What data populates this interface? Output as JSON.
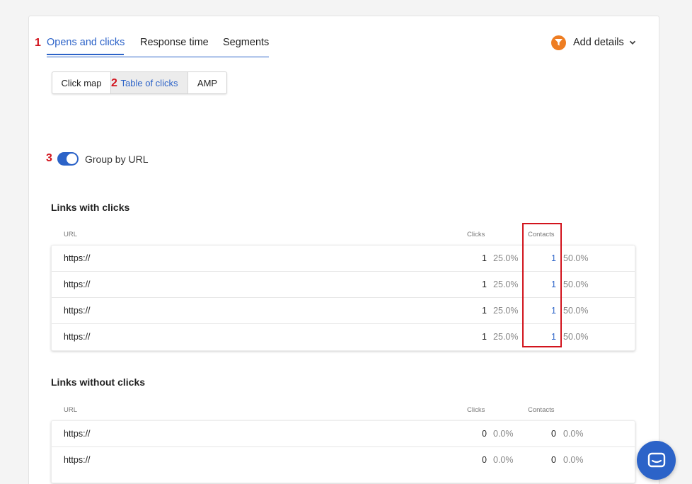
{
  "markers": {
    "m1": "1",
    "m2": "2",
    "m3": "3"
  },
  "tabs": [
    {
      "label": "Opens and clicks",
      "active": true
    },
    {
      "label": "Response time",
      "active": false
    },
    {
      "label": "Segments",
      "active": false
    }
  ],
  "add_details": {
    "label": "Add details",
    "icon": "filter-icon",
    "color": "#ee7d22"
  },
  "view_switch": [
    {
      "label": "Click map",
      "active": false
    },
    {
      "label": "Table of clicks",
      "active": true
    },
    {
      "label": "AMP",
      "active": false
    }
  ],
  "group_toggle": {
    "label": "Group by URL",
    "on": true
  },
  "links_with_clicks": {
    "title": "Links with clicks",
    "columns": {
      "url": "URL",
      "clicks": "Clicks",
      "contacts": "Contacts"
    },
    "rows": [
      {
        "url": "https://",
        "clicks": "1",
        "clicks_pct": "25.0%",
        "contacts": "1",
        "contacts_pct": "50.0%"
      },
      {
        "url": "https://",
        "clicks": "1",
        "clicks_pct": "25.0%",
        "contacts": "1",
        "contacts_pct": "50.0%"
      },
      {
        "url": "https://",
        "clicks": "1",
        "clicks_pct": "25.0%",
        "contacts": "1",
        "contacts_pct": "50.0%"
      },
      {
        "url": "https://",
        "clicks": "1",
        "clicks_pct": "25.0%",
        "contacts": "1",
        "contacts_pct": "50.0%"
      }
    ]
  },
  "links_without_clicks": {
    "title": "Links without clicks",
    "columns": {
      "url": "URL",
      "clicks": "Clicks",
      "contacts": "Contacts"
    },
    "rows": [
      {
        "url": "https://",
        "clicks": "0",
        "clicks_pct": "0.0%",
        "contacts": "0",
        "contacts_pct": "0.0%"
      },
      {
        "url": "https://",
        "clicks": "0",
        "clicks_pct": "0.0%",
        "contacts": "0",
        "contacts_pct": "0.0%"
      }
    ]
  },
  "colors": {
    "accent": "#2c63c8",
    "annotation": "#d2141d",
    "orange": "#ee7d22"
  },
  "chat_button": {
    "icon": "chat-icon"
  }
}
